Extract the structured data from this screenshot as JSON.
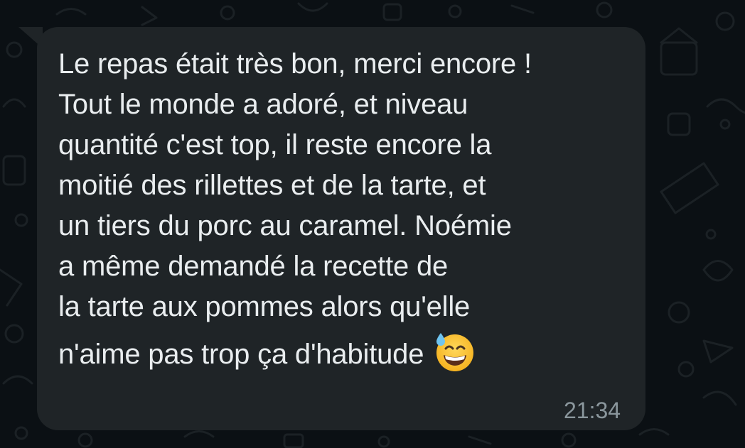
{
  "message": {
    "lines": [
      "Le repas était très bon, merci encore !",
      "Tout le monde a adoré, et niveau",
      "quantité c'est top, il reste encore la",
      "moitié des rillettes et de la tarte, et",
      "un tiers du porc au caramel. Noémie",
      "a même demandé la recette de",
      "la tarte aux pommes alors qu'elle",
      "n'aime pas trop ça d'habitude"
    ],
    "emoji": "grinning-face-with-sweat-icon",
    "time": "21:34"
  },
  "colors": {
    "background": "#0b1014",
    "bubble": "#1f2427",
    "text": "#e9edef",
    "timestamp": "#8a969c"
  }
}
